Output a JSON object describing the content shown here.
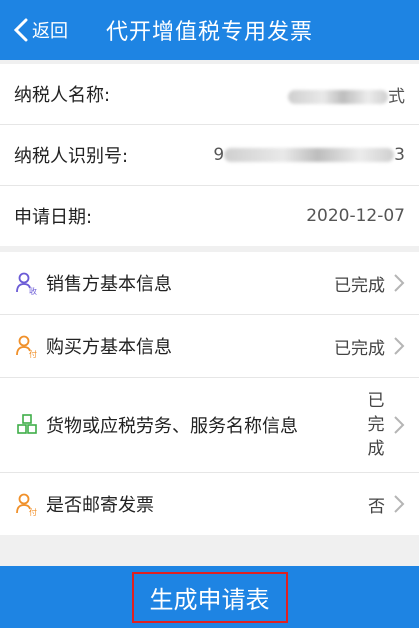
{
  "header": {
    "back_label": "返回",
    "title": "代开增值税专用发票"
  },
  "info": {
    "taxpayer_name_label": "纳税人名称:",
    "taxpayer_name_value_suffix": "式",
    "taxpayer_id_label": "纳税人识别号:",
    "taxpayer_id_value_prefix": "9",
    "taxpayer_id_value_suffix": "3",
    "apply_date_label": "申请日期:",
    "apply_date_value": "2020-12-07"
  },
  "menu": {
    "items": [
      {
        "label": "销售方基本信息",
        "status": "已完成",
        "icon": "seller-user-icon"
      },
      {
        "label": "购买方基本信息",
        "status": "已完成",
        "icon": "buyer-user-icon"
      },
      {
        "label": "货物或应税劳务、服务名称信息",
        "status": "已完成",
        "icon": "goods-cubes-icon"
      },
      {
        "label": "是否邮寄发票",
        "status": "否",
        "icon": "mail-user-icon"
      }
    ]
  },
  "footer": {
    "generate_label": "生成申请表"
  },
  "colors": {
    "header": "#1e84e3",
    "seller_icon": "#6b5bd6",
    "buyer_icon": "#f0902a",
    "goods_icon": "#3fae49",
    "button_outline": "#e02020"
  }
}
